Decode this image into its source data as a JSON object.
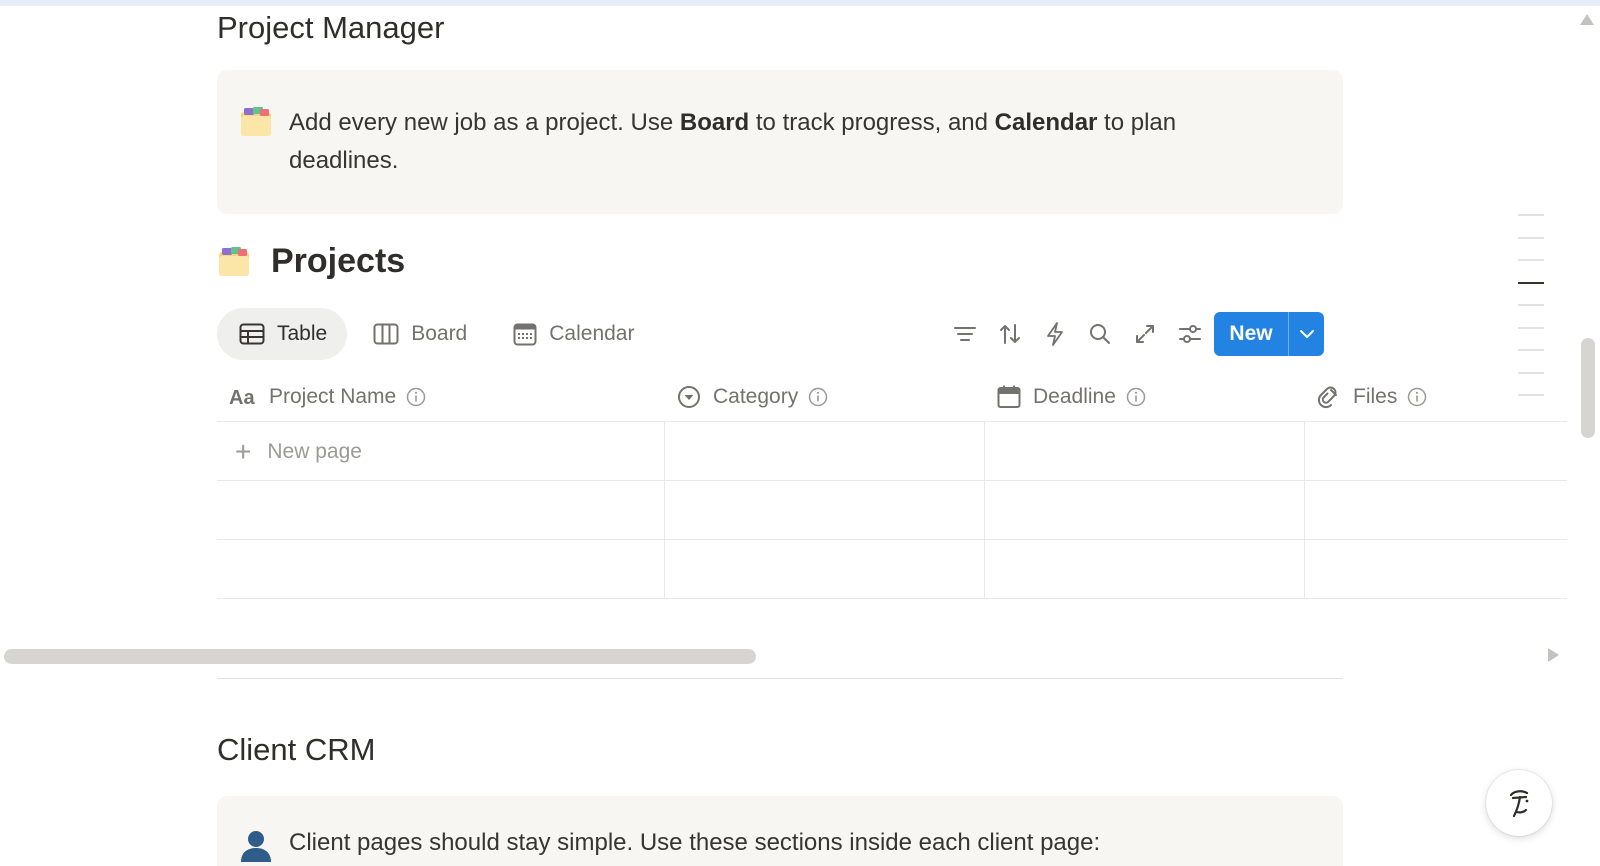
{
  "sections": {
    "project_manager": {
      "title": "Project Manager",
      "callout": {
        "icon": "folder-emoji",
        "text_1": "Add every new job as a project. Use ",
        "bold_1": "Board",
        "text_2": " to track progress, and ",
        "bold_2": "Calendar",
        "text_3": " to plan deadlines."
      }
    },
    "client_crm": {
      "title": "Client CRM",
      "callout": {
        "icon": "person-silhouette-emoji",
        "text": "Client pages should stay simple. Use these sections inside each client page:"
      }
    }
  },
  "database": {
    "icon": "folder-emoji",
    "title": "Projects",
    "views": [
      {
        "label": "Table",
        "icon": "table-icon",
        "active": true
      },
      {
        "label": "Board",
        "icon": "board-icon",
        "active": false
      },
      {
        "label": "Calendar",
        "icon": "calendar-icon",
        "active": false
      }
    ],
    "tools": [
      "filter-icon",
      "sort-icon",
      "automation-bolt-icon",
      "search-icon",
      "expand-icon",
      "settings-sliders-icon"
    ],
    "new_button": {
      "label": "New"
    },
    "columns": [
      {
        "label": "Project Name",
        "icon": "text-property-icon"
      },
      {
        "label": "Category",
        "icon": "select-property-icon"
      },
      {
        "label": "Deadline",
        "icon": "date-property-icon"
      },
      {
        "label": "Files",
        "icon": "attachment-property-icon"
      }
    ],
    "new_page_label": "New page"
  },
  "colors": {
    "accent": "#2383e2",
    "text": "#37352f",
    "muted": "#73726e",
    "callout_bg": "#f7f6f3"
  }
}
